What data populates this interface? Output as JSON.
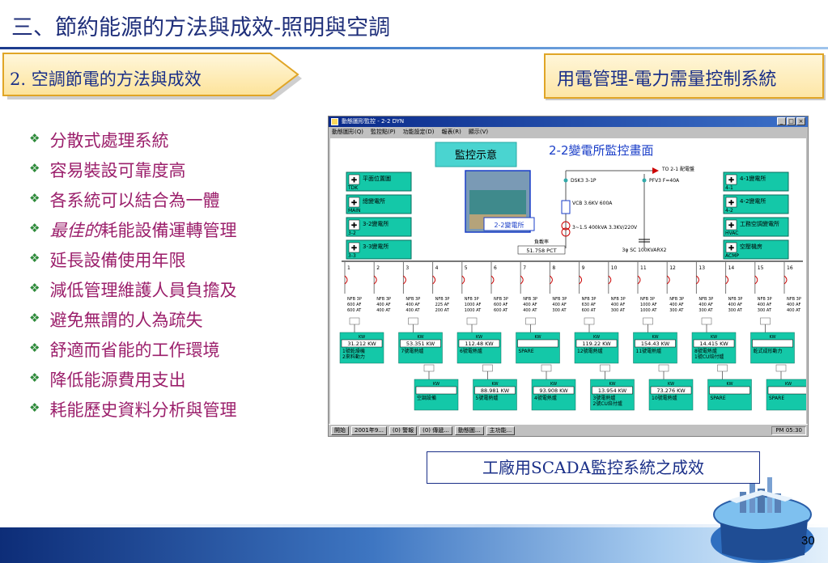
{
  "title": "三、節約能源的方法與成效-照明與空調",
  "subtitle_left": "2. 空調節電的方法與成效",
  "subtitle_right": "用電管理-電力需量控制系統",
  "bullets": [
    {
      "em": "",
      "text": "分散式處理系統"
    },
    {
      "em": "",
      "text": "容易裝設可靠度高"
    },
    {
      "em": "",
      "text": "各系統可以結合為一體"
    },
    {
      "em": "最佳的",
      "text": "耗能設備運轉管理"
    },
    {
      "em": "",
      "text": "延長設備使用年限"
    },
    {
      "em": "",
      "text": "減低管理維護人員負擔及"
    },
    {
      "em": "",
      "text": "避免無謂的人為疏失"
    },
    {
      "em": "",
      "text": "舒適而省能的工作環境"
    },
    {
      "em": "",
      "text": "降低能源費用支出"
    },
    {
      "em": "",
      "text": "耗能歷史資料分析與管理"
    }
  ],
  "bullet_mark": "❖",
  "colors": {
    "title": "#1f2f7a",
    "bullet_text": "#9b1f6b",
    "bullet_mark": "#2e8a3a",
    "scada_panel": "#14c8a8",
    "scada_label": "#1a3ec8"
  },
  "scada": {
    "window_title": "動態圖形監控 - 2-2 DYN",
    "window_buttons": [
      "_",
      "□",
      "×"
    ],
    "menu": [
      "動態圖形(Q)",
      "監控點(P)",
      "功能設定(D)",
      "報表(R)",
      "顯示(V)"
    ],
    "overlay_label": "監控示意",
    "screen_title": "2-2變電所監控畫面",
    "photo_label": "2-2變電所",
    "left_nav": [
      {
        "label": "平面位置圖",
        "code": "TDK"
      },
      {
        "label": "總變電所",
        "code": "MAIN"
      },
      {
        "label": "3-2變電所",
        "code": "3-2"
      },
      {
        "label": "3-3變電所",
        "code": "3-3"
      }
    ],
    "right_nav": [
      {
        "label": "4-1變電所",
        "code": "4-1"
      },
      {
        "label": "4-2變電所",
        "code": "4-2"
      },
      {
        "label": "工務空調變電所",
        "code": "HVAC"
      },
      {
        "label": "空壓機房",
        "code": "ACMP"
      }
    ],
    "feed": {
      "to_label": "TO 2-1 配電盤",
      "breaker_a": "DSK3 3-1P",
      "breaker_b": "PFV3 F=40A",
      "vcb": "VCB 3.6KV 600A",
      "transformer": "3~1.5 400kVA 3.3KV/220V",
      "capacitor": "3φ SC 100KVARX2",
      "load_rate_label": "負載率",
      "load_rate_value": "51.758 PCT"
    },
    "feeders": [
      {
        "no": "1",
        "nfb": "NFB 3P 600 AF 600 AT"
      },
      {
        "no": "2",
        "nfb": "NFB 3P 400 AF 400 AT"
      },
      {
        "no": "3",
        "nfb": "NFB 3P 400 AF 400 AT"
      },
      {
        "no": "4",
        "nfb": "NFB 3P 225 AF 200 AT"
      },
      {
        "no": "5",
        "nfb": "NFB 3P 1000 AF 1000 AT"
      },
      {
        "no": "6",
        "nfb": "NFB 3P 600 AF 600 AT"
      },
      {
        "no": "7",
        "nfb": "NFB 3P 400 AF 400 AT"
      },
      {
        "no": "8",
        "nfb": "NFB 3P 400 AF 300 AT"
      },
      {
        "no": "9",
        "nfb": "NFB 3P 630 AF 600 AT"
      },
      {
        "no": "10",
        "nfb": "NFB 3P 400 AF 300 AT"
      },
      {
        "no": "11",
        "nfb": "NFB 3P 1000 AF 1000 AT"
      },
      {
        "no": "12",
        "nfb": "NFB 3P 400 AF 300 AT"
      },
      {
        "no": "13",
        "nfb": "NFB 3P 400 AF 300 AT"
      },
      {
        "no": "14",
        "nfb": "NFB 3P 400 AF 300 AT"
      },
      {
        "no": "15",
        "nfb": "NFB 3P 400 AF 300 AT"
      },
      {
        "no": "16",
        "nfb": "NFB 3P 400 AF 400 AT"
      }
    ],
    "loads_top": [
      {
        "unit": "KW",
        "value": "31.212 KW",
        "name": "1號乾燥機 2來料動力"
      },
      {
        "unit": "KW",
        "value": "53.351 KW",
        "name": "7號電熱爐"
      },
      {
        "unit": "KW",
        "value": "112.48 KW",
        "name": "6號電熱爐"
      },
      {
        "unit": "KW",
        "value": "",
        "name": "SPARE"
      },
      {
        "unit": "KW",
        "value": "119.22 KW",
        "name": "12號電熱爐"
      },
      {
        "unit": "KW",
        "value": "154.43 KW",
        "name": "11號電熱爐"
      },
      {
        "unit": "KW",
        "value": "14.415 KW",
        "name": "8號電熱爐 1號CU焙付爐"
      },
      {
        "unit": "KW",
        "value": "",
        "name": "乾式成形動力"
      }
    ],
    "loads_bottom": [
      {
        "unit": "KW",
        "value": "",
        "name": "空調設備"
      },
      {
        "unit": "KW",
        "value": "88.981 KW",
        "name": "5號電熱爐"
      },
      {
        "unit": "KW",
        "value": "93.908 KW",
        "name": "4號電熱爐"
      },
      {
        "unit": "KW",
        "value": "13.954 KW",
        "name": "3號電熱爐 2號CU焙付爐"
      },
      {
        "unit": "KW",
        "value": "73.276 KW",
        "name": "10號電熱爐"
      },
      {
        "unit": "KW",
        "value": "",
        "name": "SPARE"
      },
      {
        "unit": "KW",
        "value": "",
        "name": "SPARE"
      }
    ],
    "taskbar": {
      "start": "開始",
      "tasks": [
        "2001年9...",
        "(0) 警報",
        "(0) 傳遞...",
        "動態圖...",
        "主功能..."
      ],
      "clock": "PM 05:30"
    }
  },
  "caption": "工廠用SCADA監控系統之成效",
  "page_number": "30"
}
